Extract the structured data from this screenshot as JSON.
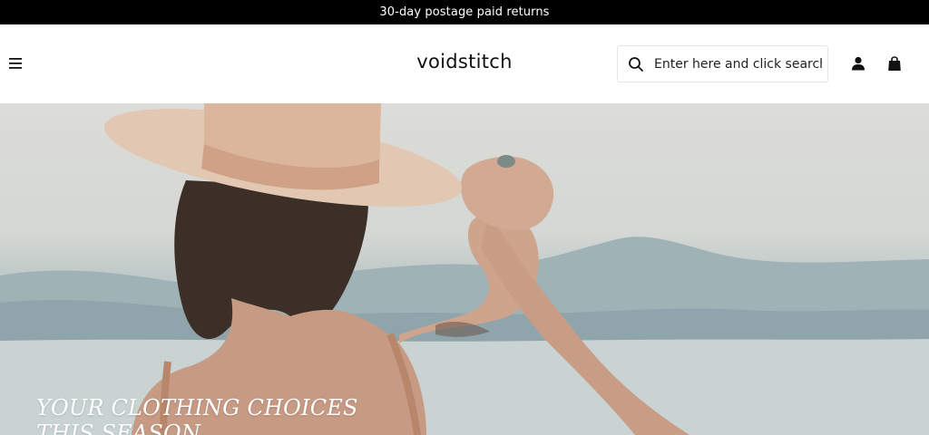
{
  "announcement": {
    "text": "30-day postage paid returns"
  },
  "header": {
    "menu_icon": "hamburger-menu-icon",
    "logo": "voidstitch",
    "search": {
      "placeholder": "Enter here and click search",
      "icon": "search-icon"
    },
    "account_icon": "user-icon",
    "cart_icon": "shopping-bag-icon"
  },
  "hero": {
    "title_line1": "YOUR CLOTHING CHOICES",
    "title_line2": "THIS SEASON",
    "image": "woman-in-wide-brim-hat-photo"
  },
  "colors": {
    "announcement_bg": "#000000",
    "announcement_text": "#ffffff",
    "hero_text": "#ffffff"
  }
}
